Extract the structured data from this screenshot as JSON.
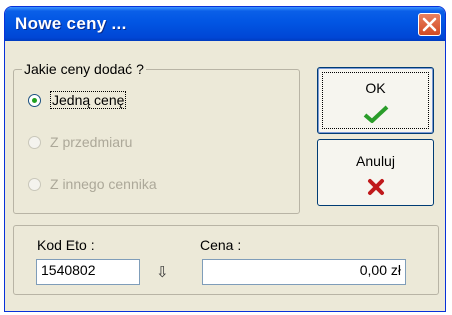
{
  "window": {
    "title": "Nowe ceny ..."
  },
  "price_type_group": {
    "legend": "Jakie ceny dodać ?",
    "options": [
      {
        "label": "Jedną cenę",
        "selected": true,
        "enabled": true
      },
      {
        "label": "Z przedmiaru",
        "selected": false,
        "enabled": false
      },
      {
        "label": "Z innego cennika",
        "selected": false,
        "enabled": false
      }
    ]
  },
  "buttons": {
    "ok_label": "OK",
    "cancel_label": "Anuluj"
  },
  "fields": {
    "kod_label": "Kod Eto :",
    "kod_value": "1540802",
    "cena_label": "Cena :",
    "cena_value": "0,00 zł"
  },
  "icons": {
    "close": "close-icon",
    "ok": "checkmark-icon",
    "cancel": "cross-icon",
    "lookup": "down-arrow-icon"
  },
  "colors": {
    "title_bar": "#0155e3",
    "close_button": "#d24a24",
    "check": "#2a9d2a",
    "cross": "#c0191b"
  }
}
